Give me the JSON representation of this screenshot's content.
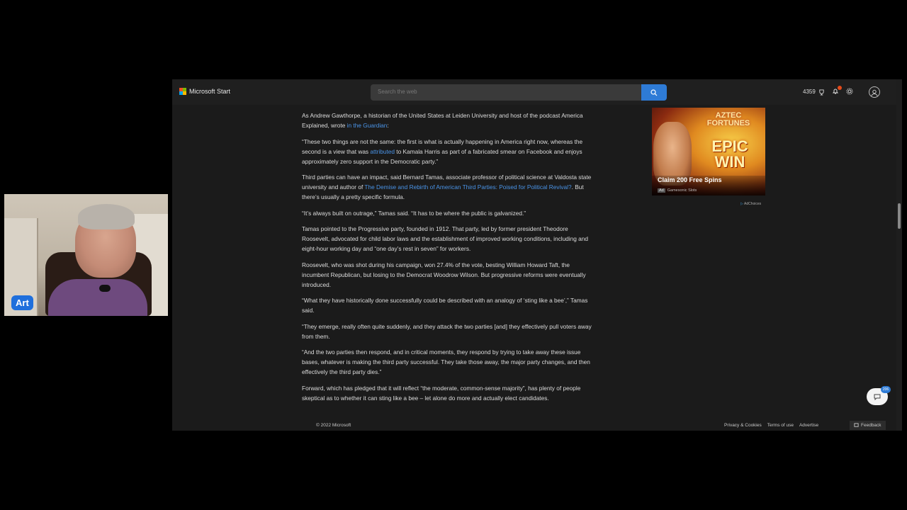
{
  "webcam": {
    "name_label": "Art"
  },
  "header": {
    "brand": "Microsoft Start",
    "search_placeholder": "Search the web",
    "points": "4359",
    "colors": {
      "accent": "#2e7bd6"
    }
  },
  "article": {
    "p1_pre": "As Andrew Gawthorpe, a historian of the United States at Leiden University and host of the podcast America Explained, wrote ",
    "p1_link": "in the Guardian",
    "p1_post": ":",
    "p2_pre": "“These two things are not the same: the first is what is actually happening in America right now, whereas the second is a view that was ",
    "p2_link": "attributed",
    "p2_post": " to Kamala Harris as part of a fabricated smear on Facebook and enjoys approximately zero support in the Democratic party.”",
    "p3_pre": "Third parties can have an impact, said Bernard Tamas, associate professor of political science at Valdosta state university and author of ",
    "p3_link": "The Demise and Rebirth of American Third Parties: Poised for Political Revival?",
    "p3_post": ". But there’s usually a pretty specific formula.",
    "p4": "“It’s always built on outrage,” Tamas said. “It has to be where the public is galvanized.”",
    "p5": "Tamas pointed to the Progressive party, founded in 1912. That party, led by former president Theodore Roosevelt, advocated for child labor laws and the establishment of improved working conditions, including and eight-hour working day and “one day’s rest in seven” for workers.",
    "p6": "Roosevelt, who was shot during his campaign, won 27.4% of the vote, besting William Howard Taft, the incumbent Republican, but losing to the Democrat Woodrow Wilson. But progressive reforms were eventually introduced.",
    "p7": "“What they have historically done successfully could be described with an analogy of ‘sting like a bee’,” Tamas said.",
    "p8": "“They emerge, really often quite suddenly, and they attack the two parties [and] they effectively pull voters away from them.",
    "p9": "“And the two parties then respond, and in critical moments, they respond by trying to take away these issue bases, whatever is making the third party successful. They take those away, the major party changes, and then effectively the third party dies.”",
    "p10": "Forward, which has pledged that it will reflect “the moderate, common-sense majority”, has plenty of people skeptical as to whether it can sting like a bee – let alone do more and actually elect candidates."
  },
  "ad": {
    "title_line1": "AZTEC",
    "title_line2": "FORTUNES",
    "epic_line1": "EPIC",
    "epic_line2": "WIN",
    "claim": "Claim 200 Free Spins",
    "badge": "Ad",
    "sponsor": "Gamesonic Slots",
    "adchoices": "AdChoices"
  },
  "footer": {
    "copyright": "© 2022 Microsoft",
    "links": [
      "Privacy & Cookies",
      "Terms of use",
      "Advertise"
    ],
    "feedback": "Feedback"
  },
  "chat": {
    "badge": "206"
  }
}
